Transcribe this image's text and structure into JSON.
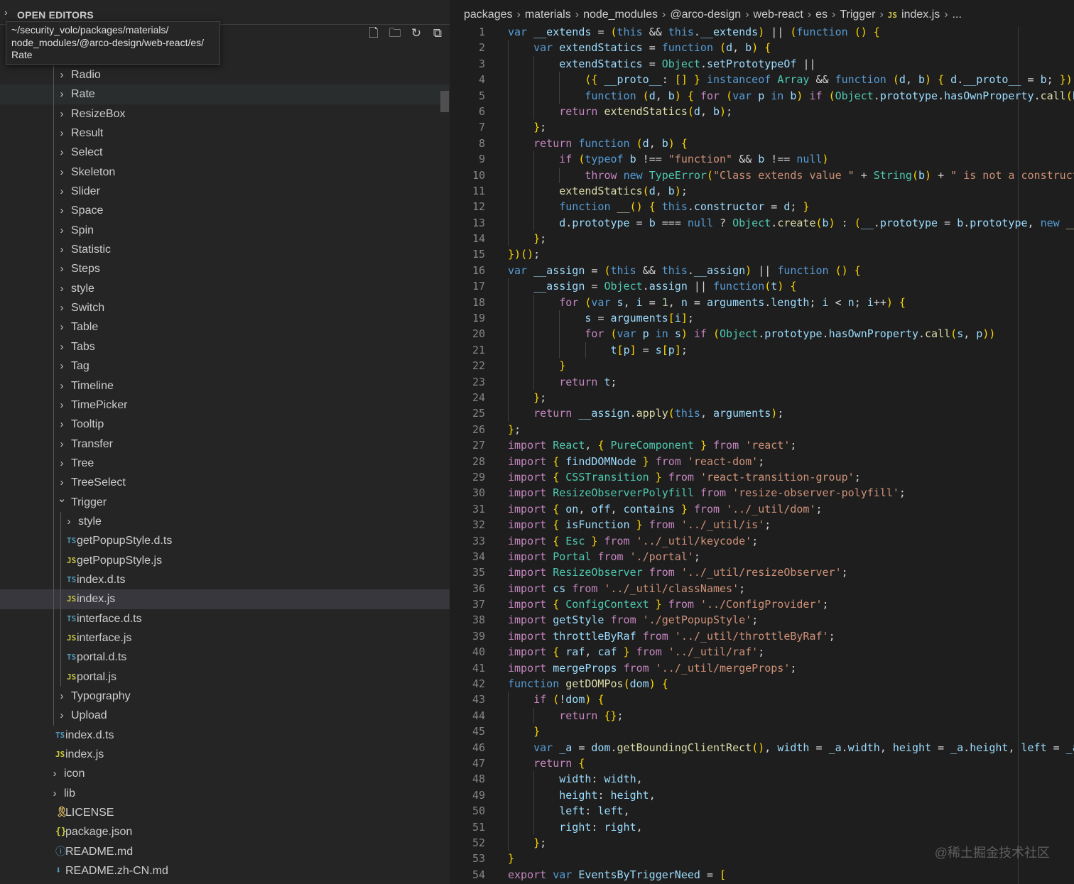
{
  "sidebar": {
    "title": "OPEN EDITORS",
    "tooltip_lines": [
      "~/security_volc/packages/materials/",
      "node_modules/@arco-design/web-react/es/",
      "Rate"
    ],
    "toolbar": [
      {
        "name": "new-file-icon",
        "glyph": "🗋"
      },
      {
        "name": "new-folder-icon",
        "glyph": "🗀"
      },
      {
        "name": "refresh-icon",
        "glyph": "↻"
      },
      {
        "name": "collapse-all-icon",
        "glyph": "⧉"
      }
    ],
    "tree": [
      {
        "label": "Radio",
        "kind": "folder",
        "depth": 2
      },
      {
        "label": "Rate",
        "kind": "folder",
        "depth": 2,
        "state": "hover"
      },
      {
        "label": "ResizeBox",
        "kind": "folder",
        "depth": 2
      },
      {
        "label": "Result",
        "kind": "folder",
        "depth": 2
      },
      {
        "label": "Select",
        "kind": "folder",
        "depth": 2
      },
      {
        "label": "Skeleton",
        "kind": "folder",
        "depth": 2
      },
      {
        "label": "Slider",
        "kind": "folder",
        "depth": 2
      },
      {
        "label": "Space",
        "kind": "folder",
        "depth": 2
      },
      {
        "label": "Spin",
        "kind": "folder",
        "depth": 2
      },
      {
        "label": "Statistic",
        "kind": "folder",
        "depth": 2
      },
      {
        "label": "Steps",
        "kind": "folder",
        "depth": 2
      },
      {
        "label": "style",
        "kind": "folder",
        "depth": 2
      },
      {
        "label": "Switch",
        "kind": "folder",
        "depth": 2
      },
      {
        "label": "Table",
        "kind": "folder",
        "depth": 2
      },
      {
        "label": "Tabs",
        "kind": "folder",
        "depth": 2
      },
      {
        "label": "Tag",
        "kind": "folder",
        "depth": 2
      },
      {
        "label": "Timeline",
        "kind": "folder",
        "depth": 2
      },
      {
        "label": "TimePicker",
        "kind": "folder",
        "depth": 2
      },
      {
        "label": "Tooltip",
        "kind": "folder",
        "depth": 2
      },
      {
        "label": "Transfer",
        "kind": "folder",
        "depth": 2
      },
      {
        "label": "Tree",
        "kind": "folder",
        "depth": 2
      },
      {
        "label": "TreeSelect",
        "kind": "folder",
        "depth": 2
      },
      {
        "label": "Trigger",
        "kind": "folder-open",
        "depth": 2
      },
      {
        "label": "style",
        "kind": "folder",
        "depth": 3
      },
      {
        "label": "getPopupStyle.d.ts",
        "kind": "ts",
        "badge": "TS",
        "depth": 3
      },
      {
        "label": "getPopupStyle.js",
        "kind": "js",
        "badge": "JS",
        "depth": 3
      },
      {
        "label": "index.d.ts",
        "kind": "ts",
        "badge": "TS",
        "depth": 3
      },
      {
        "label": "index.js",
        "kind": "js",
        "badge": "JS",
        "depth": 3,
        "state": "selected"
      },
      {
        "label": "interface.d.ts",
        "kind": "ts",
        "badge": "TS",
        "depth": 3
      },
      {
        "label": "interface.js",
        "kind": "js",
        "badge": "JS",
        "depth": 3
      },
      {
        "label": "portal.d.ts",
        "kind": "ts",
        "badge": "TS",
        "depth": 3
      },
      {
        "label": "portal.js",
        "kind": "js",
        "badge": "JS",
        "depth": 3
      },
      {
        "label": "Typography",
        "kind": "folder",
        "depth": 2
      },
      {
        "label": "Upload",
        "kind": "folder",
        "depth": 2
      },
      {
        "label": "index.d.ts",
        "kind": "ts",
        "badge": "TS",
        "depth": 1
      },
      {
        "label": "index.js",
        "kind": "js",
        "badge": "JS",
        "depth": 1
      },
      {
        "label": "icon",
        "kind": "folder",
        "depth": 1
      },
      {
        "label": "lib",
        "kind": "folder",
        "depth": 1
      },
      {
        "label": "LICENSE",
        "kind": "license",
        "depth": 1
      },
      {
        "label": "package.json",
        "kind": "json",
        "badge": "{}",
        "depth": 1
      },
      {
        "label": "README.md",
        "kind": "info",
        "depth": 1
      },
      {
        "label": "README.zh-CN.md",
        "kind": "md-down",
        "depth": 1
      }
    ]
  },
  "breadcrumbs": [
    "packages",
    "materials",
    "node_modules",
    "@arco-design",
    "web-react",
    "es",
    "Trigger",
    "index.js",
    "..."
  ],
  "breadcrumb_file_badge": "JS",
  "code_lines": [
    "var __extends = (this && this.__extends) || (function () {",
    "    var extendStatics = function (d, b) {",
    "        extendStatics = Object.setPrototypeOf ||",
    "            ({ __proto__: [] } instanceof Array && function (d, b) { d.__proto__ = b; }) ||",
    "            function (d, b) { for (var p in b) if (Object.prototype.hasOwnProperty.call(b, p)) d[p] = b[p]; };",
    "        return extendStatics(d, b);",
    "    };",
    "    return function (d, b) {",
    "        if (typeof b !== \"function\" && b !== null)",
    "            throw new TypeError(\"Class extends value \" + String(b) + \" is not a constructor or null\");",
    "        extendStatics(d, b);",
    "        function __() { this.constructor = d; }",
    "        d.prototype = b === null ? Object.create(b) : (__.prototype = b.prototype, new __());",
    "    };",
    "})();",
    "var __assign = (this && this.__assign) || function () {",
    "    __assign = Object.assign || function(t) {",
    "        for (var s, i = 1, n = arguments.length; i < n; i++) {",
    "            s = arguments[i];",
    "            for (var p in s) if (Object.prototype.hasOwnProperty.call(s, p))",
    "                t[p] = s[p];",
    "        }",
    "        return t;",
    "    };",
    "    return __assign.apply(this, arguments);",
    "};",
    "import React, { PureComponent } from 'react';",
    "import { findDOMNode } from 'react-dom';",
    "import { CSSTransition } from 'react-transition-group';",
    "import ResizeObserverPolyfill from 'resize-observer-polyfill';",
    "import { on, off, contains } from '../_util/dom';",
    "import { isFunction } from '../_util/is';",
    "import { Esc } from '../_util/keycode';",
    "import Portal from './portal';",
    "import ResizeObserver from '../_util/resizeObserver';",
    "import cs from '../_util/classNames';",
    "import { ConfigContext } from '../ConfigProvider';",
    "import getStyle from './getPopupStyle';",
    "import throttleByRaf from '../_util/throttleByRaf';",
    "import { raf, caf } from '../_util/raf';",
    "import mergeProps from '../_util/mergeProps';",
    "function getDOMPos(dom) {",
    "    if (!dom) {",
    "        return {};",
    "    }",
    "    var _a = dom.getBoundingClientRect(), width = _a.width, height = _a.height, left = _a.left, right = _a.right;",
    "    return {",
    "        width: width,",
    "        height: height,",
    "        left: left,",
    "        right: right,",
    "    };",
    "}",
    "export var EventsByTriggerNeed = ["
  ],
  "watermark": "@稀土掘金技术社区",
  "colors": {
    "sidebar_bg": "#252526",
    "editor_bg": "#1e1e1e",
    "selected_row": "#37373d",
    "ts_badge": "#519aba",
    "js_badge": "#cbcb41",
    "keyword_blue": "#569cd6",
    "keyword_purple": "#c586c0",
    "string": "#ce9178",
    "function": "#dcdcaa",
    "type": "#4ec9b0",
    "variable": "#9cdcfe"
  }
}
